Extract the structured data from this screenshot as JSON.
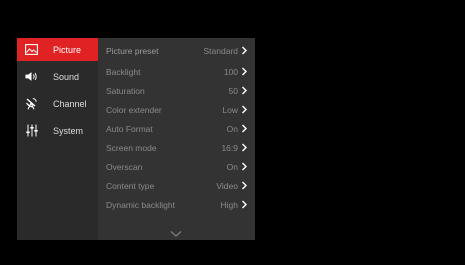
{
  "sidebar": {
    "items": [
      {
        "label": "Picture",
        "icon": "picture-icon",
        "active": true
      },
      {
        "label": "Sound",
        "icon": "speaker-icon",
        "active": false
      },
      {
        "label": "Channel",
        "icon": "antenna-icon",
        "active": false
      },
      {
        "label": "System",
        "icon": "sliders-icon",
        "active": false
      }
    ]
  },
  "settings": {
    "rows": [
      {
        "label": "Picture preset",
        "value": "Standard"
      },
      {
        "label": "Backlight",
        "value": "100"
      },
      {
        "label": "Saturation",
        "value": "50"
      },
      {
        "label": "Color extender",
        "value": "Low"
      },
      {
        "label": "Auto Format",
        "value": "On"
      },
      {
        "label": "Screen mode",
        "value": "16:9"
      },
      {
        "label": "Overscan",
        "value": "On"
      },
      {
        "label": "Content type",
        "value": "Video"
      },
      {
        "label": "Dynamic backlight",
        "value": "High"
      }
    ],
    "more_indicator": "chevron-down-icon"
  },
  "colors": {
    "active_accent": "#e02222",
    "sidebar_bg": "#2a2a2a",
    "settings_bg": "#333333",
    "screen_bg": "#000000"
  }
}
